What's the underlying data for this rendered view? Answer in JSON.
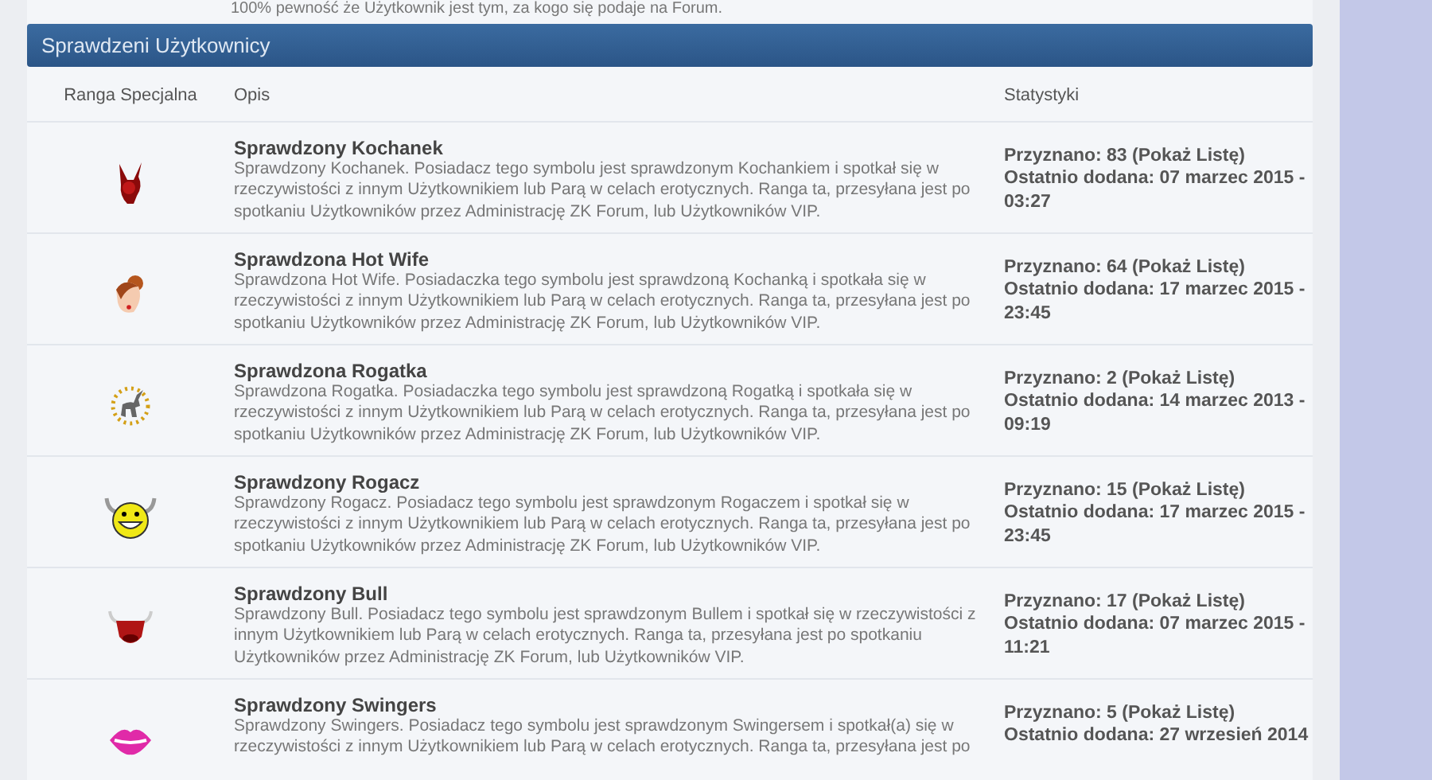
{
  "intro_text": "100% pewność że Użytkownik jest tym, za kogo się podaje na Forum.",
  "section": {
    "title": "Sprawdzeni Użytkownicy"
  },
  "columns": [
    "Ranga Specjalna",
    "Opis",
    "Statystyki"
  ],
  "rows": [
    {
      "name": "Sprawdzony Kochanek",
      "description": "Sprawdzony Kochanek. Posiadacz tego symbolu jest sprawdzonym Kochankiem i spotkał się w rzeczywistości z innym Użytkownikiem lub Parą w celach erotycznych. Ranga ta, przesyłana jest po spotkaniu Użytkowników przez Administrację ZK Forum, lub Użytkowników VIP.",
      "awarded": "Przyznano: 83",
      "link": "(Pokaż Listę)",
      "last_added": "Ostatnio dodana: 07 marzec 2015 - 03:27"
    },
    {
      "name": "Sprawdzona Hot Wife",
      "description": "Sprawdzona Hot Wife. Posiadaczka tego symbolu jest sprawdzoną Kochanką i spotkała się w rzeczywistości z innym Użytkownikiem lub Parą w celach erotycznych. Ranga ta, przesyłana jest po spotkaniu Użytkowników przez Administrację ZK Forum, lub Użytkowników VIP.",
      "awarded": "Przyznano: 64",
      "link": "(Pokaż Listę)",
      "last_added": "Ostatnio dodana: 17 marzec 2015 - 23:45"
    },
    {
      "name": "Sprawdzona Rogatka",
      "description": "Sprawdzona Rogatka. Posiadaczka tego symbolu jest sprawdzoną Rogatką i spotkała się w rzeczywistości z innym Użytkownikiem lub Parą w celach erotycznych. Ranga ta, przesyłana jest po spotkaniu Użytkowników przez Administrację ZK Forum, lub Użytkowników VIP.",
      "awarded": "Przyznano: 2",
      "link": "(Pokaż Listę)",
      "last_added": "Ostatnio dodana: 14 marzec 2013 - 09:19"
    },
    {
      "name": "Sprawdzony Rogacz",
      "description": "Sprawdzony Rogacz. Posiadacz tego symbolu jest sprawdzonym Rogaczem i spotkał się w rzeczywistości z innym Użytkownikiem lub Parą w celach erotycznych. Ranga ta, przesyłana jest po spotkaniu Użytkowników przez Administrację ZK Forum, lub Użytkowników VIP.",
      "awarded": "Przyznano: 15",
      "link": "(Pokaż Listę)",
      "last_added": "Ostatnio dodana: 17 marzec 2015 - 23:45"
    },
    {
      "name": "Sprawdzony Bull",
      "description": "Sprawdzony Bull. Posiadacz tego symbolu jest sprawdzonym Bullem i spotkał się w rzeczywistości z innym Użytkownikiem lub Parą w celach erotycznych. Ranga ta, przesyłana jest po spotkaniu Użytkowników przez Administrację ZK Forum, lub Użytkowników VIP.",
      "awarded": "Przyznano: 17",
      "link": "(Pokaż Listę)",
      "last_added": "Ostatnio dodana: 07 marzec 2015 - 11:21"
    },
    {
      "name": "Sprawdzony Swingers",
      "description": "Sprawdzony Swingers. Posiadacz tego symbolu jest sprawdzonym Swingersem i spotkał(a) się w rzeczywistości z innym Użytkownikiem lub Parą w celach erotycznych. Ranga ta, przesyłana jest po",
      "awarded": "Przyznano: 5",
      "link": "(Pokaż Listę)",
      "last_added": "Ostatnio dodana: 27 wrzesień 2014"
    }
  ]
}
